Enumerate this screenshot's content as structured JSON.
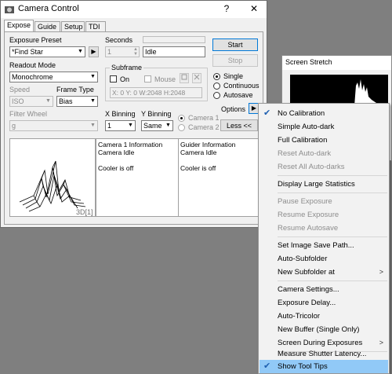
{
  "window": {
    "title": "Camera Control",
    "help": "?",
    "close": "✕",
    "tabs": [
      "Expose",
      "Guide",
      "Setup",
      "TDI"
    ]
  },
  "expose": {
    "exposure_preset_label": "Exposure Preset",
    "exposure_preset_value": "*Find Star",
    "seconds_label": "Seconds",
    "seconds_value": "1",
    "status_value": "Idle",
    "start_label": "Start",
    "stop_label": "Stop",
    "readout_mode_label": "Readout Mode",
    "readout_mode_value": "Monochrome",
    "subframe_label": "Subframe",
    "on_label": "On",
    "mouse_label": "Mouse",
    "subframe_coords": "X:   0 Y:   0 W:2048 H:2048",
    "speed_label": "Speed",
    "speed_value": "ISO",
    "frame_type_label": "Frame Type",
    "frame_type_value": "Bias",
    "mode_single": "Single",
    "mode_continuous": "Continuous",
    "mode_autosave": "Autosave",
    "filter_wheel_label": "Filter Wheel",
    "filter_wheel_value": "g",
    "x_binning_label": "X Binning",
    "x_binning_value": "1",
    "y_binning_label": "Y Binning",
    "y_binning_value": "Same",
    "camera1_label": "Camera 1",
    "camera2_label": "Camera 2",
    "options_label": "Options",
    "less_label": "Less <<",
    "preview_badge": "3D[1]",
    "camera_info_title": "Camera 1 Information",
    "camera_info_status": "Camera Idle",
    "camera_info_cooler": "Cooler is off",
    "guider_info_title": "Guider Information",
    "guider_info_status": "Camera Idle",
    "guider_info_cooler": "Cooler is off"
  },
  "stretch": {
    "title": "Screen Stretch"
  },
  "menu": {
    "items": [
      {
        "label": "No Calibration",
        "checked": true,
        "enabled": true
      },
      {
        "label": "Simple Auto-dark",
        "enabled": true
      },
      {
        "label": "Full Calibration",
        "enabled": true
      },
      {
        "label": "Reset Auto-dark",
        "enabled": false
      },
      {
        "label": "Reset All Auto-darks",
        "enabled": false
      },
      {
        "label": "Display Large Statistics",
        "enabled": true
      },
      {
        "label": "Pause Exposure",
        "enabled": false
      },
      {
        "label": "Resume Exposure",
        "enabled": false
      },
      {
        "label": "Resume Autosave",
        "enabled": false
      },
      {
        "label": "Set Image Save Path...",
        "enabled": true
      },
      {
        "label": "Auto-Subfolder",
        "enabled": true
      },
      {
        "label": "New Subfolder at",
        "enabled": true,
        "submenu": true
      },
      {
        "label": "Camera Settings...",
        "enabled": true
      },
      {
        "label": "Exposure Delay...",
        "enabled": true
      },
      {
        "label": "Auto-Tricolor",
        "enabled": true
      },
      {
        "label": "New Buffer (Single Only)",
        "enabled": true
      },
      {
        "label": "Screen During Exposures",
        "enabled": true,
        "submenu": true
      },
      {
        "label": "Measure Shutter Latency...",
        "enabled": true
      },
      {
        "label": "Show Tool Tips",
        "checked": true,
        "enabled": true,
        "highlighted": true
      }
    ],
    "submenu_arrow": ">",
    "check_glyph": "✔"
  },
  "colors": {
    "menu_highlight": "#91c9f7",
    "default_button_border": "#0078d7"
  }
}
